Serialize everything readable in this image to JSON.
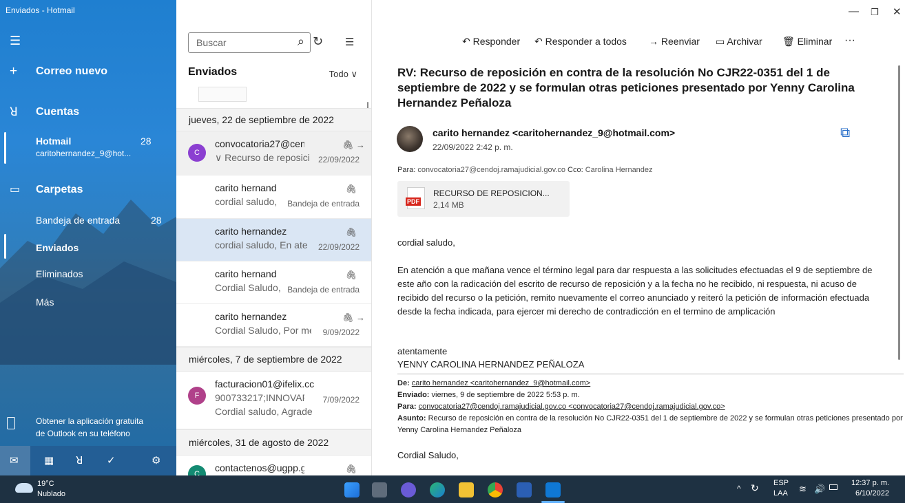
{
  "window": {
    "title": "Enviados - Hotmail"
  },
  "nav": {
    "new_mail": "Correo nuevo",
    "accounts_label": "Cuentas",
    "account": {
      "name": "Hotmail",
      "count": "28",
      "email": "caritohernandez_9@hot..."
    },
    "folders_label": "Carpetas",
    "folders": [
      {
        "label": "Bandeja de entrada",
        "count": "28"
      },
      {
        "label": "Enviados",
        "count": ""
      },
      {
        "label": "Eliminados",
        "count": ""
      },
      {
        "label": "Más",
        "count": ""
      }
    ],
    "promo": [
      "Obtener la aplicación gratuita",
      "de Outlook en su teléfono"
    ]
  },
  "list": {
    "search_placeholder": "Buscar",
    "title": "Enviados",
    "filter": "Todo",
    "date_headers": [
      "jueves, 22 de septiembre de 2022",
      "miércoles, 7 de septiembre de 2022",
      "miércoles, 31 de agosto de 2022"
    ],
    "messages": [
      {
        "from": "convocatoria27@cenc",
        "subject": "∨ Recurso de reposici",
        "meta": "22/09/2022",
        "avatar": "C",
        "avatar_color": "#8b3fd1"
      },
      {
        "from": "carito hernand",
        "subject": "cordial saludo,",
        "meta": "Bandeja de entrada"
      },
      {
        "from": "carito hernandez",
        "subject": "cordial saludo, En ater",
        "meta": "22/09/2022"
      },
      {
        "from": "carito hernand",
        "subject": "Cordial Saludo,",
        "meta": "Bandeja de entrada"
      },
      {
        "from": "carito hernandez",
        "subject": "Cordial Saludo, Por me",
        "meta": "9/09/2022"
      },
      {
        "from": "facturacion01@ifelix.cc",
        "subject": "900733217;INNOVAR (",
        "preview": "Cordial saludo, Agrade",
        "meta": "7/09/2022",
        "avatar": "F",
        "avatar_color": "#b0418a"
      },
      {
        "from": "contactenos@ugpp.g",
        "subject": "",
        "meta": "",
        "avatar": "C",
        "avatar_color": "#138a72"
      }
    ]
  },
  "toolbar": {
    "reply": "Responder",
    "reply_all": "Responder a todos",
    "forward": "Reenviar",
    "archive": "Archivar",
    "delete": "Eliminar",
    "more": "···"
  },
  "message": {
    "subject": "RV: Recurso de reposición en contra de la resolución No  CJR22-0351 del 1 de septiembre de 2022 y se formulan otras peticiones presentado por Yenny Carolina Hernandez Peñaloza",
    "sender": "carito hernandez <caritohernandez_9@hotmail.com>",
    "date": "22/09/2022 2:42 p. m.",
    "to_label": "Para:",
    "to": "convocatoria27@cendoj.ramajudicial.gov.co",
    "cc_label": "Cco:",
    "cc": "Carolina Hernandez",
    "attachment_name": "RECURSO DE REPOSICION...",
    "attachment_size": "2,14 MB",
    "attachment_type": "PDF",
    "greeting": "cordial saludo,",
    "paragraph": "En atención a que mañana vence el término legal para dar respuesta a las solicitudes efectuadas el 9 de septiembre de este año con la radicación del escrito de recurso de reposición y a la fecha no he recibido, ni respuesta, ni acuso de recibido del recurso o la petición, remito nuevamente el correo anunciado y reiteró la petición de información efectuada desde la fecha indicada, para ejercer mi derecho de contradicción en el termino de amplicación",
    "signoff": "atentamente",
    "signature": "YENNY CAROLINA HERNANDEZ PEÑALOZA",
    "fwd": {
      "from_label": "De:",
      "from": "carito hernandez <caritohernandez_9@hotmail.com>",
      "sent_label": "Enviado:",
      "sent": "viernes, 9 de septiembre de 2022 5:53 p. m.",
      "to_label": "Para:",
      "to": "convocatoria27@cendoj.ramajudicial.gov.co <convocatoria27@cendoj.ramajudicial.gov.co>",
      "subject_label": "Asunto:",
      "subject": "Recurso de reposición en contra de la resolución No CJR22-0351 del 1 de septiembre de 2022 y se formulan otras peticiones presentado por Yenny Carolina Hernandez Peñaloza"
    },
    "closing": "Cordial Saludo,"
  },
  "taskbar": {
    "temp": "19°C",
    "condition": "Nublado",
    "lang": "ESP",
    "lang_sub": "LAA",
    "time": "12:37 p. m.",
    "date": "6/10/2022"
  }
}
